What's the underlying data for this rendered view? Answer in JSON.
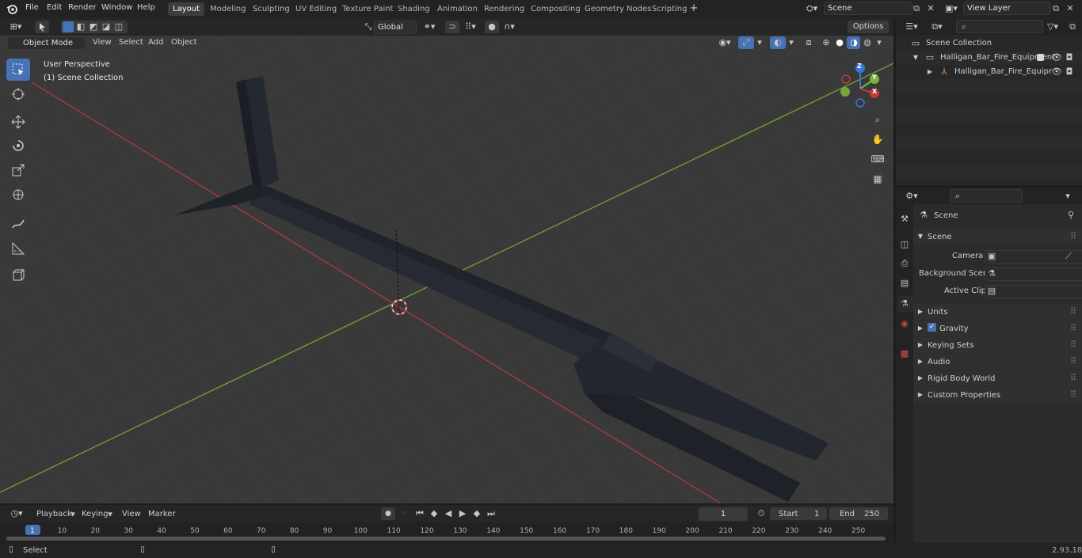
{
  "menu": {
    "items": [
      "File",
      "Edit",
      "Render",
      "Window",
      "Help"
    ]
  },
  "workspaces": [
    {
      "label": "Layout",
      "active": true
    },
    {
      "label": "Modeling"
    },
    {
      "label": "Sculpting"
    },
    {
      "label": "UV Editing"
    },
    {
      "label": "Texture Paint"
    },
    {
      "label": "Shading"
    },
    {
      "label": "Animation"
    },
    {
      "label": "Rendering"
    },
    {
      "label": "Compositing"
    },
    {
      "label": "Geometry Nodes"
    },
    {
      "label": "Scripting"
    }
  ],
  "scene_field": "Scene",
  "view_layer_field": "View Layer",
  "viewport_header": {
    "mode": "Object Mode",
    "menus": [
      "View",
      "Select",
      "Add",
      "Object"
    ],
    "transform_orientation": "Global",
    "options_label": "Options"
  },
  "viewport": {
    "perspective_label": "User Perspective",
    "collection_label": "(1) Scene Collection",
    "gizmo": {
      "z": "Z",
      "y": "Y",
      "x": "X"
    }
  },
  "outliner": {
    "scene_collection": "Scene Collection",
    "collection": "Halligan_Bar_Fire_Equipment",
    "object": "Halligan_Bar_Fire_Equipr"
  },
  "properties": {
    "context_label": "Scene",
    "section_scene": "Scene",
    "camera_label": "Camera",
    "background_scene_label": "Background Scene",
    "active_clip_label": "Active Clip",
    "panels": [
      "Units",
      "Gravity",
      "Keying Sets",
      "Audio",
      "Rigid Body World",
      "Custom Properties"
    ]
  },
  "timeline": {
    "menus": [
      "Playback",
      "Keying",
      "View",
      "Marker"
    ],
    "current_frame": "1",
    "start_label": "Start",
    "start_value": "1",
    "end_label": "End",
    "end_value": "250",
    "ticks": [
      "1",
      "10",
      "20",
      "30",
      "40",
      "50",
      "60",
      "70",
      "80",
      "90",
      "100",
      "110",
      "120",
      "130",
      "140",
      "150",
      "160",
      "170",
      "180",
      "190",
      "200",
      "210",
      "220",
      "230",
      "240",
      "250"
    ]
  },
  "status": {
    "select_label": "Select",
    "version": "2.93.18"
  },
  "colors": {
    "accent": "#4772b3",
    "x_axis": "#c23b3b",
    "y_axis": "#7fb33c",
    "z_axis": "#3a74d6"
  }
}
